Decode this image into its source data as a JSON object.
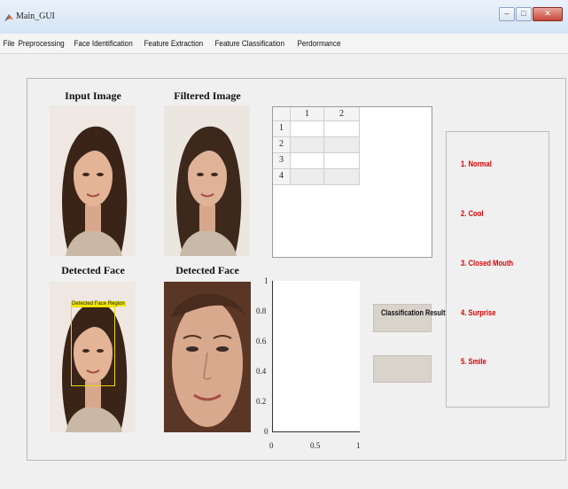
{
  "window": {
    "title": "Main_GUI"
  },
  "menu": [
    "File",
    "Preprocessing",
    "Face Identification",
    "Feature Extraction",
    "Feature Classification",
    "Perdormance"
  ],
  "images": {
    "input_title": "Input Image",
    "filtered_title": "Filtered Image",
    "detected_title_1": "Detected Face",
    "detected_title_2": "Detected Face",
    "detection_label": "Detected Face Region"
  },
  "table": {
    "columns": [
      "1",
      "2"
    ],
    "rows": [
      "1",
      "2",
      "3",
      "4"
    ]
  },
  "plot": {
    "y_ticks": [
      "1",
      "0.8",
      "0.6",
      "0.4",
      "0.2",
      "0"
    ],
    "x_ticks": [
      "0",
      "0.5",
      "1"
    ]
  },
  "buttons": {
    "classification_result": "Classification Result",
    "result_value": ""
  },
  "legend": [
    "1. Normal",
    "2. Cool",
    "3. Closed Mouth",
    "4. Surprise",
    "5. Smile"
  ],
  "colors": {
    "legend_text": "#e00000",
    "detection_box": "#e8d800"
  }
}
